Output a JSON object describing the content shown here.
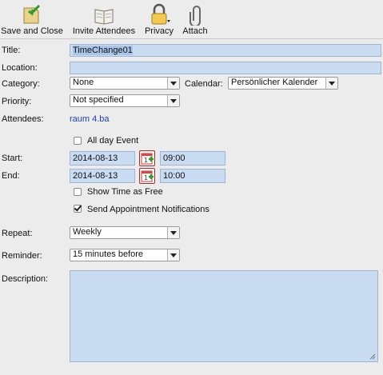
{
  "toolbar": {
    "save_label": "Save and Close",
    "invite_label": "Invite Attendees",
    "privacy_label": "Privacy",
    "attach_label": "Attach",
    "icons": [
      "save-icon",
      "invite-icon",
      "lock-icon",
      "paperclip-icon"
    ]
  },
  "form": {
    "title_label": "Title:",
    "title_value": "TimeChange01",
    "location_label": "Location:",
    "location_value": "",
    "category_label": "Category:",
    "category_value": "None",
    "calendar_label": "Calendar:",
    "calendar_value": "Persönlicher Kalender",
    "priority_label": "Priority:",
    "priority_value": "Not specified",
    "attendees_label": "Attendees:",
    "attendees_value": "raum 4.ba",
    "all_day_label": "All day Event",
    "all_day_checked": false,
    "start_label": "Start:",
    "start_date": "2014-08-13",
    "start_time": "09:00",
    "end_label": "End:",
    "end_date": "2014-08-13",
    "end_time": "10:00",
    "show_free_label": "Show Time as Free",
    "show_free_checked": false,
    "send_notif_label": "Send Appointment Notifications",
    "send_notif_checked": true,
    "repeat_label": "Repeat:",
    "repeat_value": "Weekly",
    "reminder_label": "Reminder:",
    "reminder_value": "15 minutes before",
    "description_label": "Description:",
    "description_value": ""
  },
  "colors": {
    "field_bg": "#c9dcf1",
    "window_bg": "#ececec",
    "link": "#1d3fb3"
  }
}
